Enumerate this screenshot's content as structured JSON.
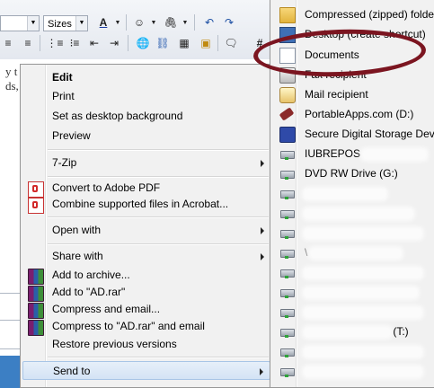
{
  "editor": {
    "font_size_label": "Sizes",
    "toolbar_hash": "#",
    "text_lines": [
      "y t",
      "ds, a"
    ]
  },
  "context_menu": {
    "items": [
      {
        "label": "Edit",
        "bold": true,
        "icon": ""
      },
      {
        "label": "Print",
        "icon": ""
      },
      {
        "label": "Set as desktop background",
        "icon": ""
      },
      {
        "label": "Preview",
        "icon": ""
      },
      {
        "label": "7-Zip",
        "icon": "",
        "submenu": true
      },
      {
        "label": "Convert to Adobe PDF",
        "icon": "adobe-pdf-icon"
      },
      {
        "label": "Combine supported files in Acrobat...",
        "icon": "acrobat-combine-icon"
      },
      {
        "label": "Open with",
        "icon": "",
        "submenu": true
      },
      {
        "label": "Share with",
        "icon": "",
        "submenu": true
      },
      {
        "label": "Add to archive...",
        "icon": "winrar-icon"
      },
      {
        "label": "Add to \"AD.rar\"",
        "icon": "winrar-icon"
      },
      {
        "label": "Compress and email...",
        "icon": "winrar-icon"
      },
      {
        "label": "Compress to \"AD.rar\" and email",
        "icon": "winrar-icon"
      },
      {
        "label": "Restore previous versions",
        "icon": ""
      },
      {
        "label": "Send to",
        "icon": "",
        "submenu": true,
        "highlighted": true
      }
    ]
  },
  "send_to": {
    "items": [
      {
        "label": "Compressed (zipped) folder",
        "icon": "zip-folder-icon"
      },
      {
        "label": "Desktop (create shortcut)",
        "icon": "desktop-icon"
      },
      {
        "label": "Documents",
        "icon": "documents-icon"
      },
      {
        "label": "Fax recipient",
        "icon": "fax-icon"
      },
      {
        "label": "Mail recipient",
        "icon": "mail-icon"
      },
      {
        "label": "PortableApps.com (D:)",
        "icon": "usb-drive-icon"
      },
      {
        "label": "Secure Digital Storage Device",
        "icon": "sd-card-icon"
      },
      {
        "label": "IUBREPOS",
        "icon": "network-drive-icon"
      },
      {
        "label": "DVD RW Drive (G:)",
        "icon": "dvd-drive-icon"
      },
      {
        "label": "",
        "icon": "network-drive-icon"
      },
      {
        "label": "",
        "icon": "network-drive-icon"
      },
      {
        "label": "",
        "icon": "network-drive-icon"
      },
      {
        "label": "\\",
        "icon": "network-drive-icon"
      },
      {
        "label": "",
        "icon": "network-drive-icon"
      },
      {
        "label": "",
        "icon": "network-drive-icon"
      },
      {
        "label": "",
        "icon": "network-drive-icon"
      },
      {
        "label": "(T:)",
        "icon": "network-drive-icon"
      },
      {
        "label": "",
        "icon": "network-drive-icon"
      },
      {
        "label": "",
        "icon": "network-drive-icon"
      }
    ]
  },
  "annotation": {
    "color": "#7b1520",
    "target": "Documents"
  }
}
